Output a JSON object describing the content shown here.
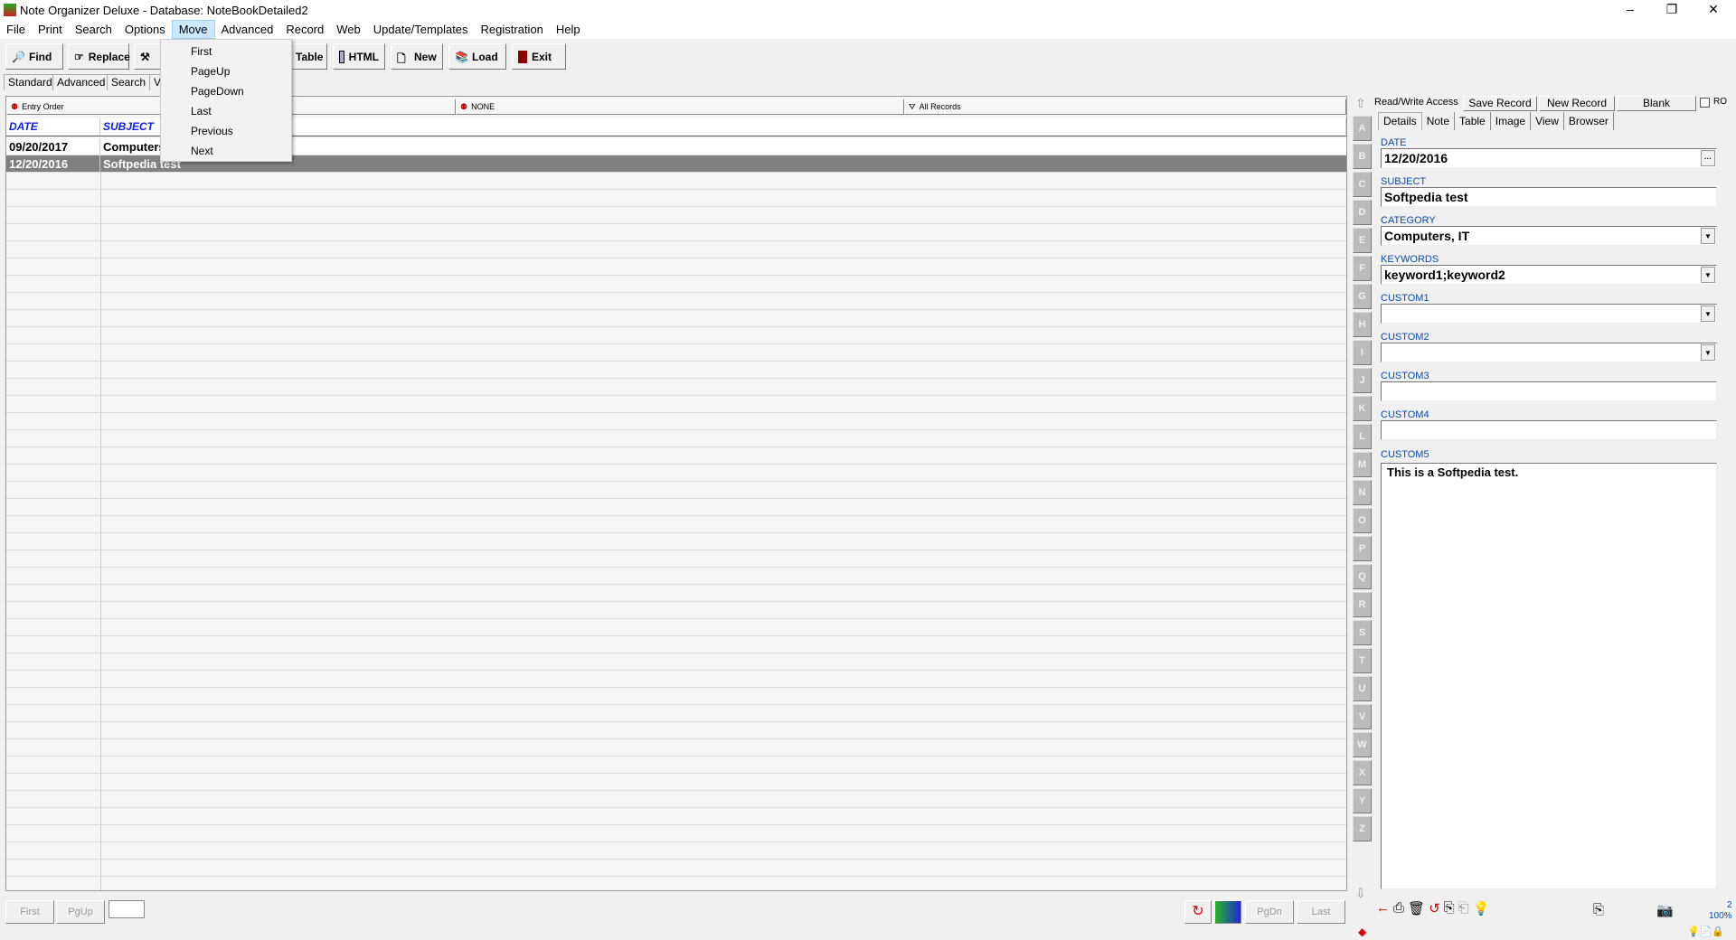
{
  "window": {
    "title": "Note Organizer Deluxe - Database: NoteBookDetailed2",
    "minimize": "–",
    "restore": "❐",
    "close": "✕"
  },
  "menu": [
    "File",
    "Print",
    "Search",
    "Options",
    "Move",
    "Advanced",
    "Record",
    "Web",
    "Update/Templates",
    "Registration",
    "Help"
  ],
  "move_menu": [
    "First",
    "PageUp",
    "PageDown",
    "Last",
    "Previous",
    "Next"
  ],
  "toolbar": {
    "find": "Find",
    "replace": "Replace",
    "table": "Table",
    "html": "HTML",
    "new": "New",
    "load": "Load",
    "exit": "Exit"
  },
  "tabs": [
    "Standard",
    "Advanced",
    "Search",
    "V"
  ],
  "list": {
    "sort": "Entry Order",
    "filter": "NONE",
    "records": "All Records",
    "columns": [
      "DATE",
      "SUBJECT"
    ],
    "rows": [
      {
        "date": "09/20/2017",
        "subject": "Computers"
      },
      {
        "date": "12/20/2016",
        "subject": "Softpedia test"
      }
    ]
  },
  "alphabet": [
    "A",
    "B",
    "C",
    "D",
    "E",
    "F",
    "G",
    "H",
    "I",
    "J",
    "K",
    "L",
    "M",
    "N",
    "O",
    "P",
    "Q",
    "R",
    "S",
    "T",
    "U",
    "V",
    "W",
    "X",
    "Y",
    "Z"
  ],
  "nav": {
    "first": "First",
    "pgup": "PgUp",
    "pgdn": "PgDn",
    "last": "Last"
  },
  "record": {
    "access": "Read/Write Access",
    "save": "Save Record",
    "new": "New Record",
    "blank": "Blank",
    "ro": "RO",
    "tabs": [
      "Details",
      "Note",
      "Table",
      "Image",
      "View",
      "Browser"
    ],
    "fields": [
      {
        "label": "DATE",
        "value": "12/20/2016"
      },
      {
        "label": "SUBJECT",
        "value": "Softpedia test"
      },
      {
        "label": "CATEGORY",
        "value": "Computers, IT"
      },
      {
        "label": "KEYWORDS",
        "value": "keyword1;keyword2"
      },
      {
        "label": "CUSTOM1",
        "value": ""
      },
      {
        "label": "CUSTOM2",
        "value": ""
      },
      {
        "label": "CUSTOM3",
        "value": ""
      },
      {
        "label": "CUSTOM4",
        "value": ""
      }
    ],
    "custom5_label": "CUSTOM5",
    "custom5_value": "This is a Softpedia test.",
    "page": "2",
    "zoom": "100%"
  },
  "colors": {
    "selected_row": "#808080",
    "column_header": "#1020e0",
    "field_label": "#0b4ba8"
  }
}
